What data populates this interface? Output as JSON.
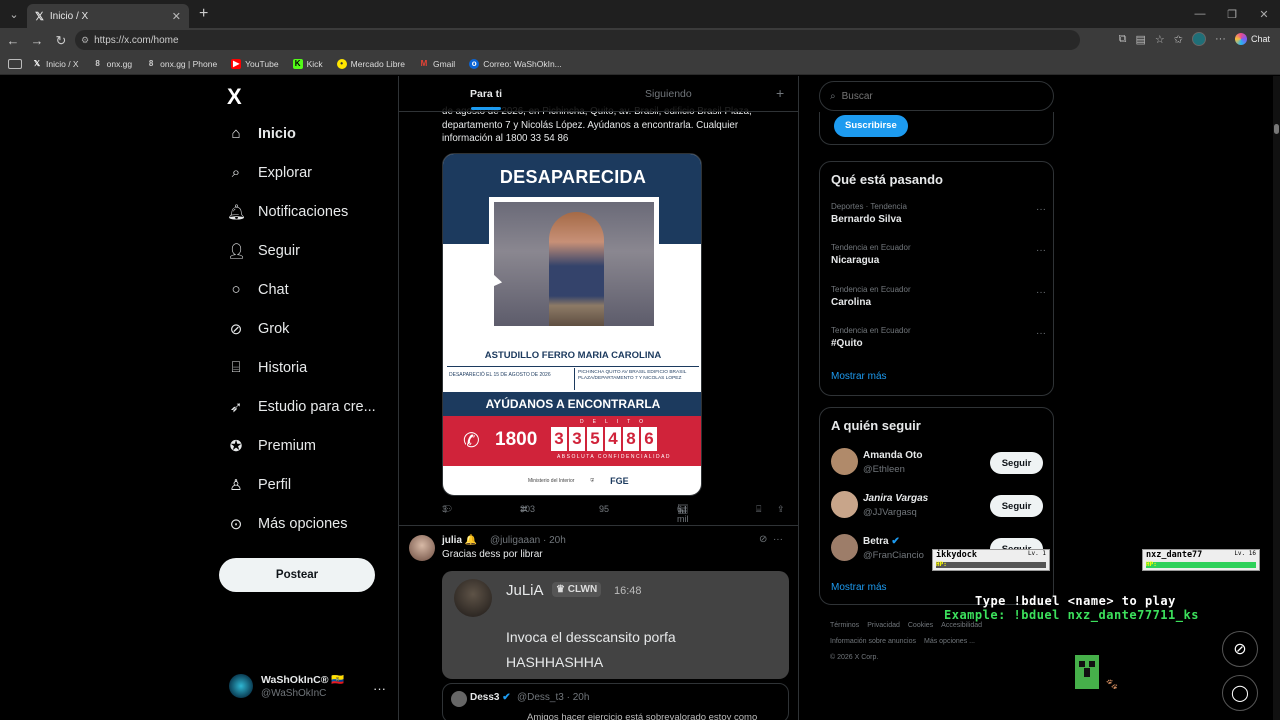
{
  "browser": {
    "tab_title": "Inicio / X",
    "url": "https://x.com/home",
    "chat_label": "Chat",
    "bookmarks": [
      "Inicio / X",
      "onx.gg",
      "onx.gg | Phone",
      "YouTube",
      "Kick",
      "Mercado Libre",
      "Gmail",
      "Correo: WaShOkIn..."
    ]
  },
  "sidebar": {
    "logo": "X",
    "items": [
      {
        "label": "Inicio",
        "icon": "home-icon"
      },
      {
        "label": "Explorar",
        "icon": "search-icon"
      },
      {
        "label": "Notificaciones",
        "icon": "bell-icon"
      },
      {
        "label": "Seguir",
        "icon": "follow-icon"
      },
      {
        "label": "Chat",
        "icon": "chat-icon"
      },
      {
        "label": "Grok",
        "icon": "grok-icon"
      },
      {
        "label": "Historia",
        "icon": "bookmark-icon"
      },
      {
        "label": "Estudio para cre...",
        "icon": "rocket-icon"
      },
      {
        "label": "Premium",
        "icon": "premium-icon"
      },
      {
        "label": "Perfil",
        "icon": "profile-icon"
      },
      {
        "label": "Más opciones",
        "icon": "more-icon"
      }
    ],
    "post_label": "Postear",
    "account": {
      "name": "WaShOkInC® 🇪🇨",
      "handle": "@WaShOkInC"
    }
  },
  "feed": {
    "tabs": [
      "Para ti",
      "Siguiendo"
    ],
    "tweet1": {
      "text": "de agosto de 2026, en Pichincha, Quito, av. Brasil, edificio Brasil Plaza, departamento 7 y Nicolás López. Ayúdanos a encontrarla. Cualquier información al 1800 33 54 86",
      "poster": {
        "title": "DESAPARECIDA",
        "name": "ASTUDILLO FERRO MARIA CAROLINA",
        "detail_left": "DESAPARECIÓ EL 15 DE AGOSTO DE 2026",
        "detail_right": "PICHINCHA QUITO AV BRASIL EDIFICIO BRASIL PLAZA/DEPARTAMENTO 7 Y NICOLAS LOPEZ",
        "help": "AYÚDANOS A ENCONTRARLA",
        "phone_prefix": "1800",
        "digits": [
          "3",
          "3",
          "5",
          "4",
          "8",
          "6"
        ],
        "delito": "DELITO",
        "confidential": "ABSOLUTA CONFIDENCIALIDAD",
        "org1": "Ministerio del Interior",
        "org2": "FGE"
      },
      "replies": "3",
      "reposts": "303",
      "likes": "95",
      "views": "6 mil"
    },
    "tweet2": {
      "name": "julia 🔔",
      "meta": "@juligaaan · 20h",
      "text": "Gracias dess por librar",
      "card": {
        "name": "JuLiA",
        "badge": "CLWN",
        "time": "16:48",
        "line1": "Invoca el desscansito porfa",
        "line2": "HASHHASHHA"
      },
      "quote": {
        "name": "Dess3",
        "meta": "@Dess_t3 · 20h",
        "text": "Amigos hacer ejercicio está sobrevalorado estoy como"
      }
    }
  },
  "right": {
    "search_placeholder": "Buscar",
    "subscribe_label": "Suscribirse",
    "trends_title": "Qué está pasando",
    "trends": [
      {
        "cat": "Deportes · Tendencia",
        "title": "Bernardo Silva"
      },
      {
        "cat": "Tendencia en Ecuador",
        "title": "Nicaragua"
      },
      {
        "cat": "Tendencia en Ecuador",
        "title": "Carolina"
      },
      {
        "cat": "Tendencia en Ecuador",
        "title": "#Quito"
      }
    ],
    "show_more": "Mostrar más",
    "follow_title": "A quién seguir",
    "follow": [
      {
        "name": "Amanda Oto",
        "handle": "@Ethleen",
        "color": "#b08a6a"
      },
      {
        "name": "Janira Vargas",
        "handle": "@JJVargasq",
        "color": "#c8a58a"
      },
      {
        "name": "Betra",
        "handle": "@FranCiancio",
        "color": "#9d7d69"
      }
    ],
    "follow_btn": "Seguir",
    "footer": [
      "Términos",
      "Privacidad",
      "Cookies",
      "Accesibilidad",
      "Información sobre anuncios",
      "Más opciones ...",
      "© 2026 X Corp."
    ]
  },
  "overlay": {
    "p1": {
      "name": "ikkydock",
      "lv": "Lv. 1",
      "hp": 0.0
    },
    "p2": {
      "name": "nxz_dante77",
      "lv": "Lv. 16",
      "hp": 1.0
    },
    "hp_label": "HP:",
    "play": "Type !bduel <name> to play",
    "example": "Example: !bduel nxz_dante77711_ks"
  }
}
